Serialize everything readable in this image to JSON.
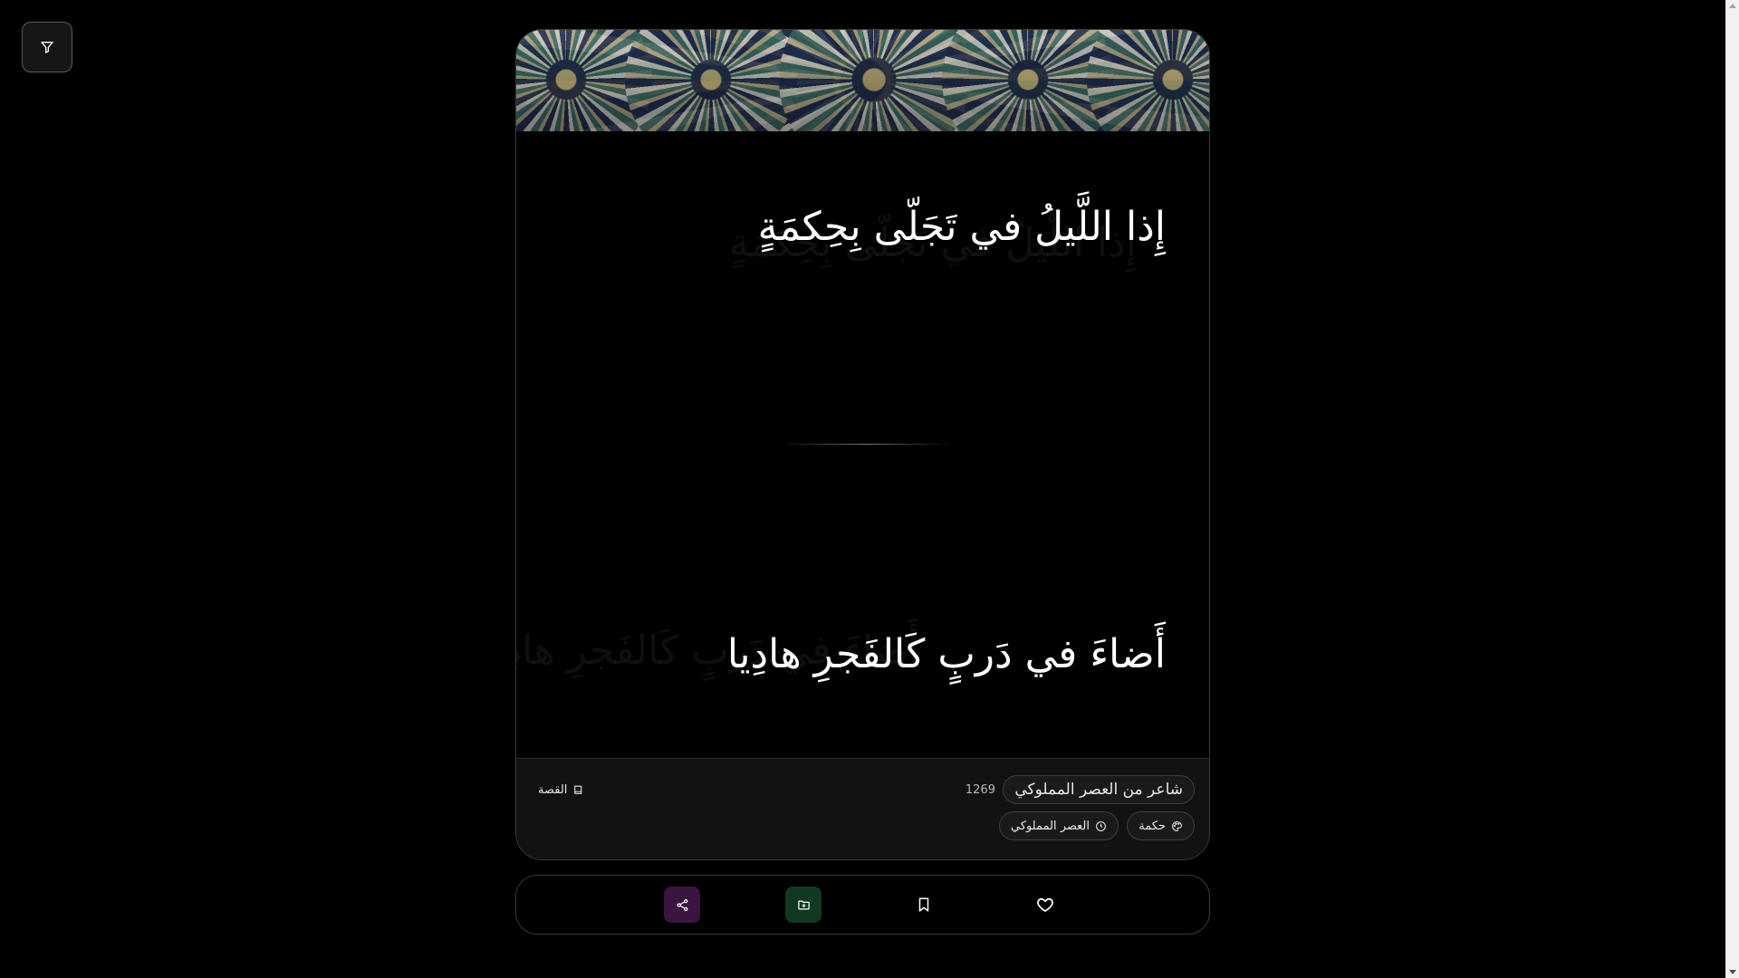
{
  "filter": {
    "icon": "filter-icon"
  },
  "poem": {
    "verse_1": "إِذا اللَّيلُ في تَجَلّى بِحِكمَةٍ",
    "verse_2": "أَضاءَ في دَربٍ كَالفَجرِ هادِيا"
  },
  "info": {
    "poet": "شاعر من العصر المملوكي",
    "poet_date": "1269",
    "story_label": "القصة",
    "tags": [
      {
        "label": "حكمة",
        "icon": "palette-icon"
      },
      {
        "label": "العصر المملوكي",
        "icon": "clock-icon"
      }
    ]
  },
  "actions": [
    {
      "name": "share",
      "icon": "share-icon",
      "color": "#3b1540"
    },
    {
      "name": "add-to-collection",
      "icon": "folder-plus-icon",
      "color": "#0f3a21"
    },
    {
      "name": "bookmark",
      "icon": "bookmark-icon"
    },
    {
      "name": "like",
      "icon": "heart-icon"
    }
  ]
}
